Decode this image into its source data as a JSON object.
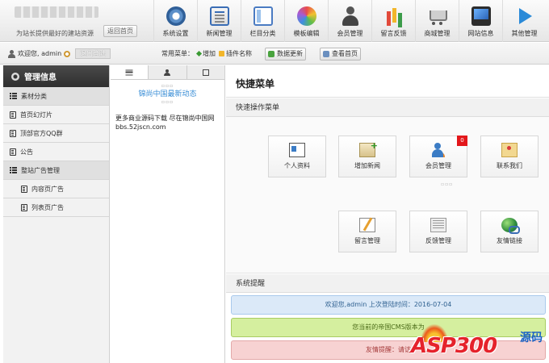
{
  "header": {
    "tagline": "为站长提供最好的建站资源",
    "back_home": "返回首页",
    "nav": [
      {
        "label": "系统设置",
        "icon": "gear-icon"
      },
      {
        "label": "新闻管理",
        "icon": "news-icon"
      },
      {
        "label": "栏目分类",
        "icon": "column-icon"
      },
      {
        "label": "模板编辑",
        "icon": "template-icon"
      },
      {
        "label": "会员管理",
        "icon": "member-icon"
      },
      {
        "label": "留言反馈",
        "icon": "feedback-icon"
      },
      {
        "label": "商城管理",
        "icon": "shop-icon"
      },
      {
        "label": "网站信息",
        "icon": "site-icon"
      },
      {
        "label": "其他管理",
        "icon": "play-icon"
      }
    ]
  },
  "subbar": {
    "welcome": "欢迎您, admin",
    "logout": "退出登陆",
    "quick_label": "常用菜单：",
    "add": "增加",
    "plugin": "插件名称",
    "update": "数据更新",
    "view_home": "查看首页"
  },
  "sidebar": {
    "title": "管理信息",
    "items": [
      {
        "label": "素材分类",
        "type": "category"
      },
      {
        "label": "首页幻灯片",
        "type": "item"
      },
      {
        "label": "顶部官方QQ群",
        "type": "item"
      },
      {
        "label": "公告",
        "type": "item"
      },
      {
        "label": "整站广告管理",
        "type": "category"
      },
      {
        "label": "内容页广告",
        "type": "sub"
      },
      {
        "label": "列表页广告",
        "type": "sub"
      }
    ]
  },
  "middle": {
    "news_title": "锦尚中国最新动态",
    "line1": "更多商业源码下载 尽在锦尚中国网",
    "line2": "bbs.52jscn.com"
  },
  "main": {
    "title": "快捷菜单",
    "quick_section": "快速操作菜单",
    "shortcuts": [
      {
        "label": "个人资料",
        "icon": "profile-icon"
      },
      {
        "label": "增加新闻",
        "icon": "add-news-icon"
      },
      {
        "label": "会员管理",
        "icon": "members-icon",
        "badge": "0"
      },
      {
        "label": "联系我们",
        "icon": "contact-icon"
      },
      {
        "label": "留言管理",
        "icon": "guestbook-icon"
      },
      {
        "label": "反馈管理",
        "icon": "feedback-manage-icon"
      },
      {
        "label": "友情链接",
        "icon": "links-icon"
      }
    ],
    "system_section": "系统提醒",
    "notices": [
      {
        "text": "欢迎您,admin 上次登陆时间：2016-07-04",
        "color": "#dbe9f8"
      },
      {
        "text": "您当前的帝国CMS版本为",
        "color": "#d5ef9f"
      },
      {
        "text": "友情提醒：请访",
        "color": "#f7d2d2"
      }
    ]
  },
  "watermark": {
    "text": "ASP300",
    "cn": "源码"
  }
}
